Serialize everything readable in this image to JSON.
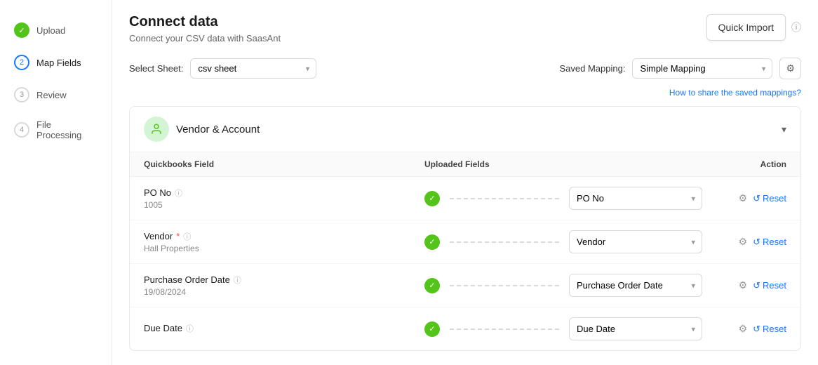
{
  "sidebar": {
    "steps": [
      {
        "id": 1,
        "label": "Upload",
        "state": "done"
      },
      {
        "id": 2,
        "label": "Map Fields",
        "state": "active"
      },
      {
        "id": 3,
        "label": "Review",
        "state": "inactive"
      },
      {
        "id": 4,
        "label": "File Processing",
        "state": "inactive"
      }
    ]
  },
  "header": {
    "title": "Connect data",
    "subtitle": "Connect your CSV data with SaasAnt",
    "quick_import_label": "Quick Import",
    "help_tooltip": "Help"
  },
  "controls": {
    "select_sheet_label": "Select Sheet:",
    "select_sheet_value": "csv sheet",
    "saved_mapping_label": "Saved Mapping:",
    "saved_mapping_value": "Simple Mapping",
    "share_link": "How to share the saved mappings?"
  },
  "section": {
    "icon": "👤",
    "title": "Vendor & Account",
    "columns": {
      "quickbooks_field": "Quickbooks Field",
      "uploaded_fields": "Uploaded Fields",
      "action": "Action"
    },
    "rows": [
      {
        "qb_field": "PO No",
        "info": true,
        "required": false,
        "value": "1005",
        "mapped_to": "PO No",
        "matched": true
      },
      {
        "qb_field": "Vendor",
        "info": true,
        "required": true,
        "value": "Hall Properties",
        "mapped_to": "Vendor",
        "matched": true
      },
      {
        "qb_field": "Purchase Order Date",
        "info": true,
        "required": false,
        "value": "19/08/2024",
        "mapped_to": "Purchase Order Date",
        "matched": true
      },
      {
        "qb_field": "Due Date",
        "info": true,
        "required": false,
        "value": "",
        "mapped_to": "Due Date",
        "matched": true
      }
    ]
  },
  "actions": {
    "reset_label": "Reset",
    "gear_label": "Settings"
  }
}
